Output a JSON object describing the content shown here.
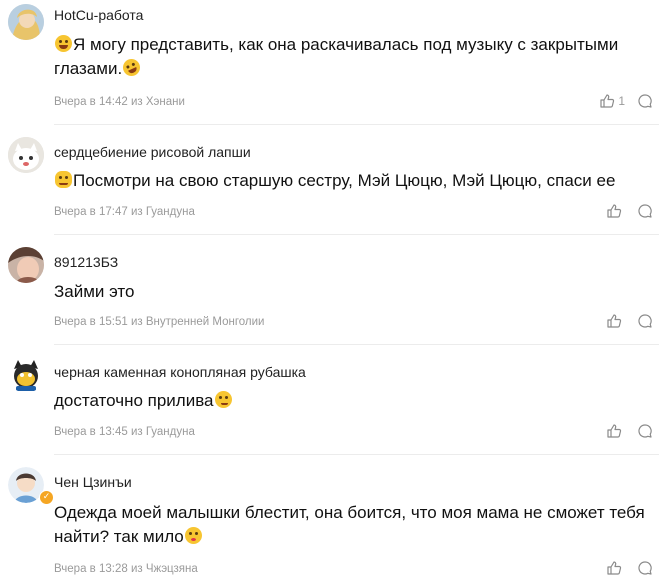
{
  "comments": [
    {
      "author": "HotCu-работа",
      "text_before": "",
      "text": "Я могу представить, как она раскачивалась под музыку с закрытыми глазами.",
      "emoji_lead": "laughing-tears-emoji",
      "emoji_trail": "rofl-emoji",
      "meta": "Вчера в 14:42 из Хэнани",
      "likes": "1"
    },
    {
      "author": "сердцебиение рисовой лапши",
      "text": "Посмотри на свою старшую сестру, Мэй Цюцю, Мэй Цюцю, спаси ее",
      "emoji_lead": "cat-face-emoji",
      "meta": "Вчера в 17:47 из Гуандуна",
      "likes": ""
    },
    {
      "author": "891213БЗ",
      "text": "Займи это",
      "meta": "Вчера в 15:51 из Внутренней Монголии",
      "likes": ""
    },
    {
      "author": "черная каменная конопляная рубашка",
      "text": "достаточно прилива",
      "emoji_trail": "thinking-emoji",
      "meta": "Вчера в 13:45 из Гуандуна",
      "likes": ""
    },
    {
      "author": "Чен Цзинъи",
      "text": "Одежда моей малышки блестит, она боится, что моя мама не сможет тебя найти? так мило",
      "emoji_trail": "kissing-heart-emoji",
      "meta": "Вчера в 13:28 из Чжэцзяна",
      "likes": "",
      "verified_badge": "✓"
    }
  ],
  "icons": {
    "like": "thumbs-up-icon",
    "reply": "comment-bubble-icon"
  },
  "colors": {
    "meta_text": "#9a9a9a",
    "emoji_yellow": "#f7c531",
    "badge": "#f5a623"
  }
}
